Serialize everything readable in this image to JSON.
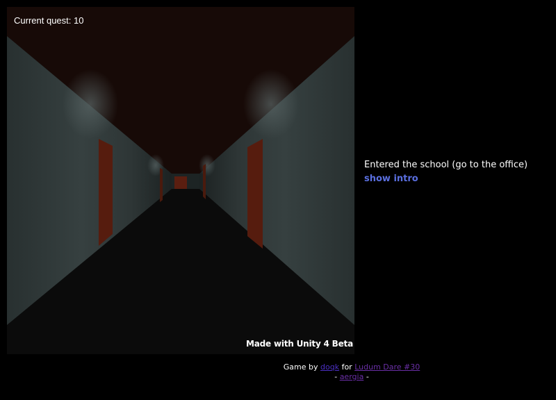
{
  "hud": {
    "quest_label": "Current quest: 10"
  },
  "badge": {
    "text": "Made with Unity 4 Beta"
  },
  "side_panel": {
    "status": "Entered the school (go to the office)",
    "intro_link": "show intro"
  },
  "footer": {
    "game_by": "Game by",
    "author": "doqk",
    "for_word": "for",
    "event": "Ludum Dare #30",
    "dash_left": "-",
    "team": "aergia",
    "dash_right": "-"
  },
  "colors": {
    "background": "#000000",
    "ceiling": "#170a07",
    "floor": "#0b0b0b",
    "wall": "#2c3433",
    "door": "#5a1e10",
    "link": "#5a6fe0"
  }
}
